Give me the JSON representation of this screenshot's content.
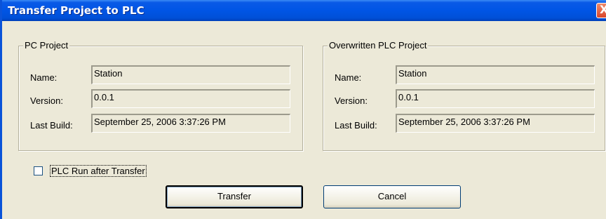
{
  "window": {
    "title": "Transfer Project to PLC",
    "close_glyph": "X"
  },
  "pc_project": {
    "legend": "PC Project",
    "name_label": "Name:",
    "name_value": "Station",
    "version_label": "Version:",
    "version_value": "0.0.1",
    "build_label": "Last Build:",
    "build_value": "September 25, 2006 3:37:26 PM"
  },
  "plc_project": {
    "legend": "Overwritten PLC Project",
    "name_label": "Name:",
    "name_value": "Station",
    "version_label": "Version:",
    "version_value": "0.0.1",
    "build_label": "Last Build:",
    "build_value": "September 25, 2006 3:37:26 PM"
  },
  "run_after": {
    "label": "PLC Run after Transfer",
    "checked": false
  },
  "buttons": {
    "transfer": "Transfer",
    "cancel": "Cancel"
  },
  "colors": {
    "titlebar": "#0055e5",
    "dialog_bg": "#ece9d8",
    "close": "#d9452a"
  }
}
